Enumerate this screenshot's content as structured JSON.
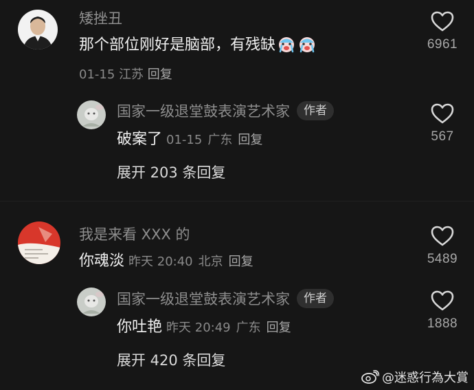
{
  "comments": [
    {
      "username": "矮挫丑",
      "text": "那个部位刚好是脑部，有残缺",
      "emoji": [
        "crying-face-icon",
        "crying-face-icon"
      ],
      "date": "01-15",
      "location": "江苏",
      "reply_label": "回复",
      "like_count": "6961",
      "reply": {
        "username": "国家一级退堂鼓表演艺术家",
        "badge": "作者",
        "text": "破案了",
        "date": "01-15",
        "location": "广东",
        "reply_label": "回复",
        "like_count": "567"
      },
      "expand_label": "展开 203 条回复"
    },
    {
      "username": "我是来看 XXX 的",
      "text": "你魂淡",
      "date": "昨天 20:40",
      "location": "北京",
      "reply_label": "回复",
      "like_count": "5489",
      "reply": {
        "username": "国家一级退堂鼓表演艺术家",
        "badge": "作者",
        "text": "你吐艳",
        "date": "昨天 20:49",
        "location": "广东",
        "reply_label": "回复",
        "like_count": "1888"
      },
      "expand_label": "展开 420 条回复"
    }
  ],
  "watermark": "@迷惑行為大賞",
  "colors": {
    "background": "#161616",
    "username": "#8e8e8e",
    "text": "#f0f0f0",
    "meta": "#8a8a8a"
  }
}
